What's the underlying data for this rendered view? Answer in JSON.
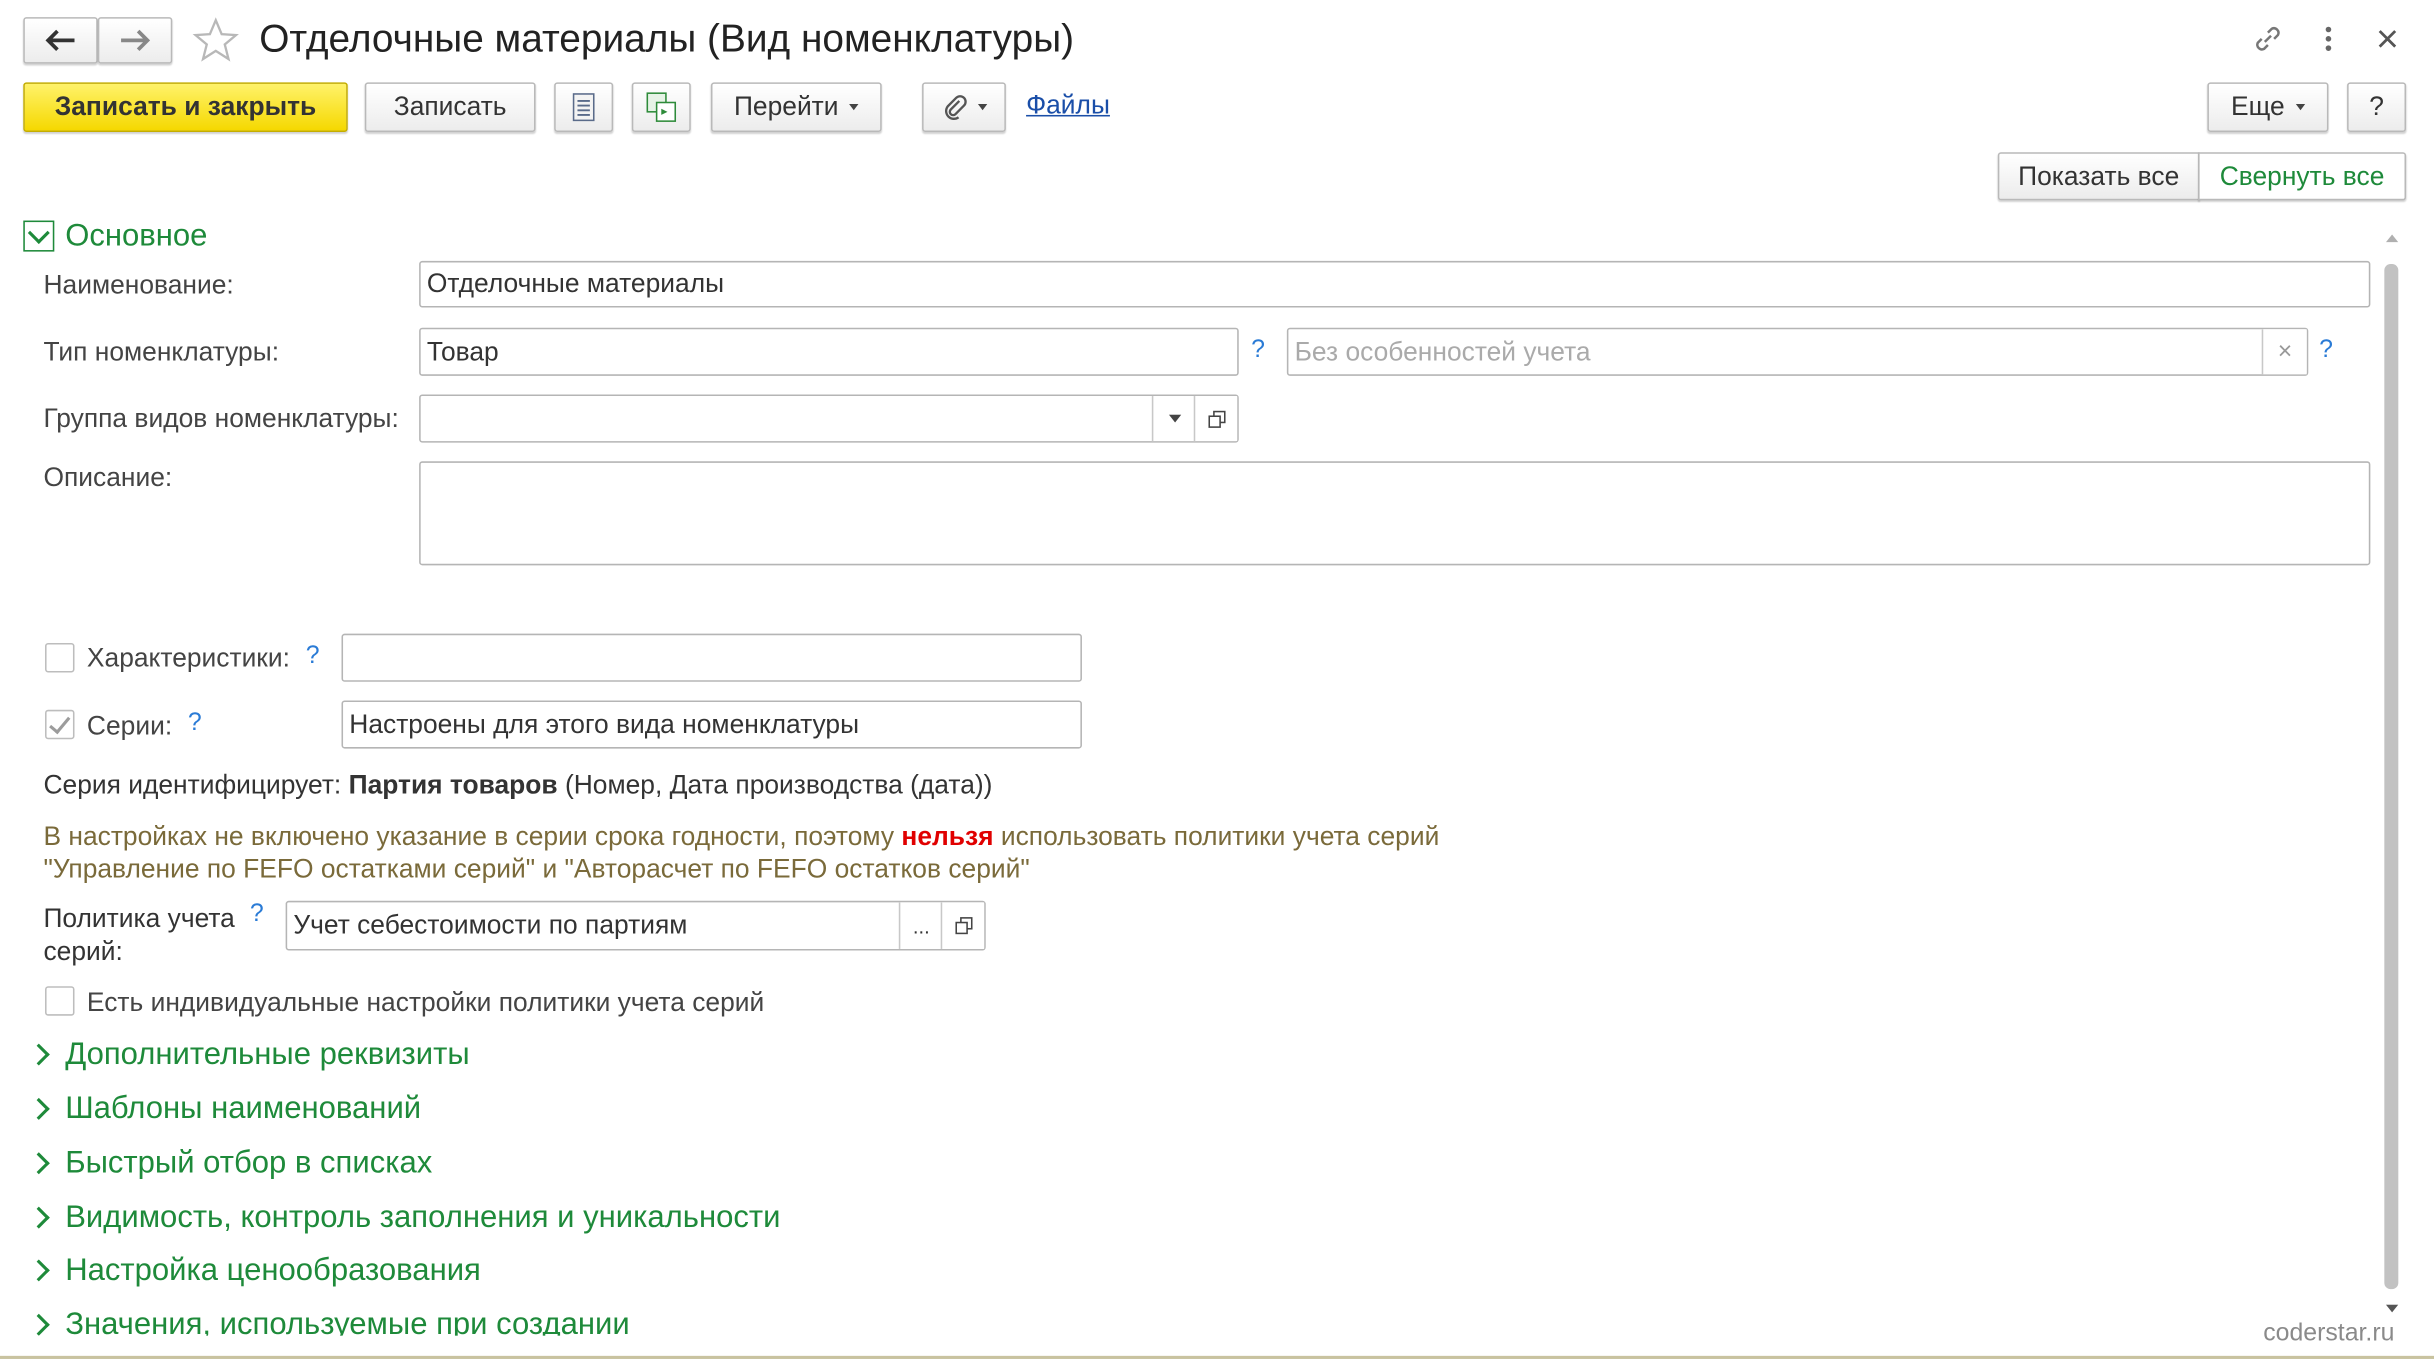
{
  "window": {
    "title": "Отделочные материалы (Вид номенклатуры)"
  },
  "toolbar": {
    "save_close": "Записать и закрыть",
    "save": "Записать",
    "goto": "Перейти",
    "files": "Файлы",
    "more": "Еще",
    "help": "?"
  },
  "panel": {
    "show_all": "Показать все",
    "collapse_all": "Свернуть все"
  },
  "main": {
    "title": "Основное",
    "name_label": "Наименование:",
    "name_value": "Отделочные материалы",
    "type_label": "Тип номенклатуры:",
    "type_value": "Товар",
    "accounting_placeholder": "Без особенностей учета",
    "group_label": "Группа видов номенклатуры:",
    "group_value": "",
    "desc_label": "Описание:",
    "desc_value": "",
    "char_label": "Характеристики:",
    "char_value": "",
    "series_label": "Серии:",
    "series_value": "Настроены для этого вида номенклатуры",
    "series_ident_prefix": "Серия идентифицирует:",
    "series_ident_bold": "Партия товаров",
    "series_ident_rest": "(Номер, Дата производства (дата))",
    "warning_1a": "В настройках не включено указание в серии срока годности, поэтому",
    "warning_1b": "нельзя",
    "warning_1c": "использовать политики учета серий",
    "warning_2": "\"Управление по FEFO остатками серий\" и \"Авторасчет по FEFO остатков серий\"",
    "policy_label_1": "Политика учета",
    "policy_label_2": "серий:",
    "policy_value": "Учет себестоимости по партиям",
    "individual_label": "Есть индивидуальные настройки политики учета серий",
    "q": "?",
    "ellipsis": "...",
    "clear": "×"
  },
  "groups": [
    "Дополнительные реквизиты",
    "Шаблоны наименований",
    "Быстрый отбор в списках",
    "Видимость, контроль заполнения и уникальности",
    "Настройка ценообразования",
    "Значения, используемые при создании"
  ],
  "watermark": "coderstar.ru",
  "colors": {
    "accent_green": "#1e8a3a",
    "primary_yellow": "#f5d800",
    "link_blue": "#1a4ea8",
    "warning_text": "#7a6a3a",
    "warning_red": "#e00000"
  }
}
